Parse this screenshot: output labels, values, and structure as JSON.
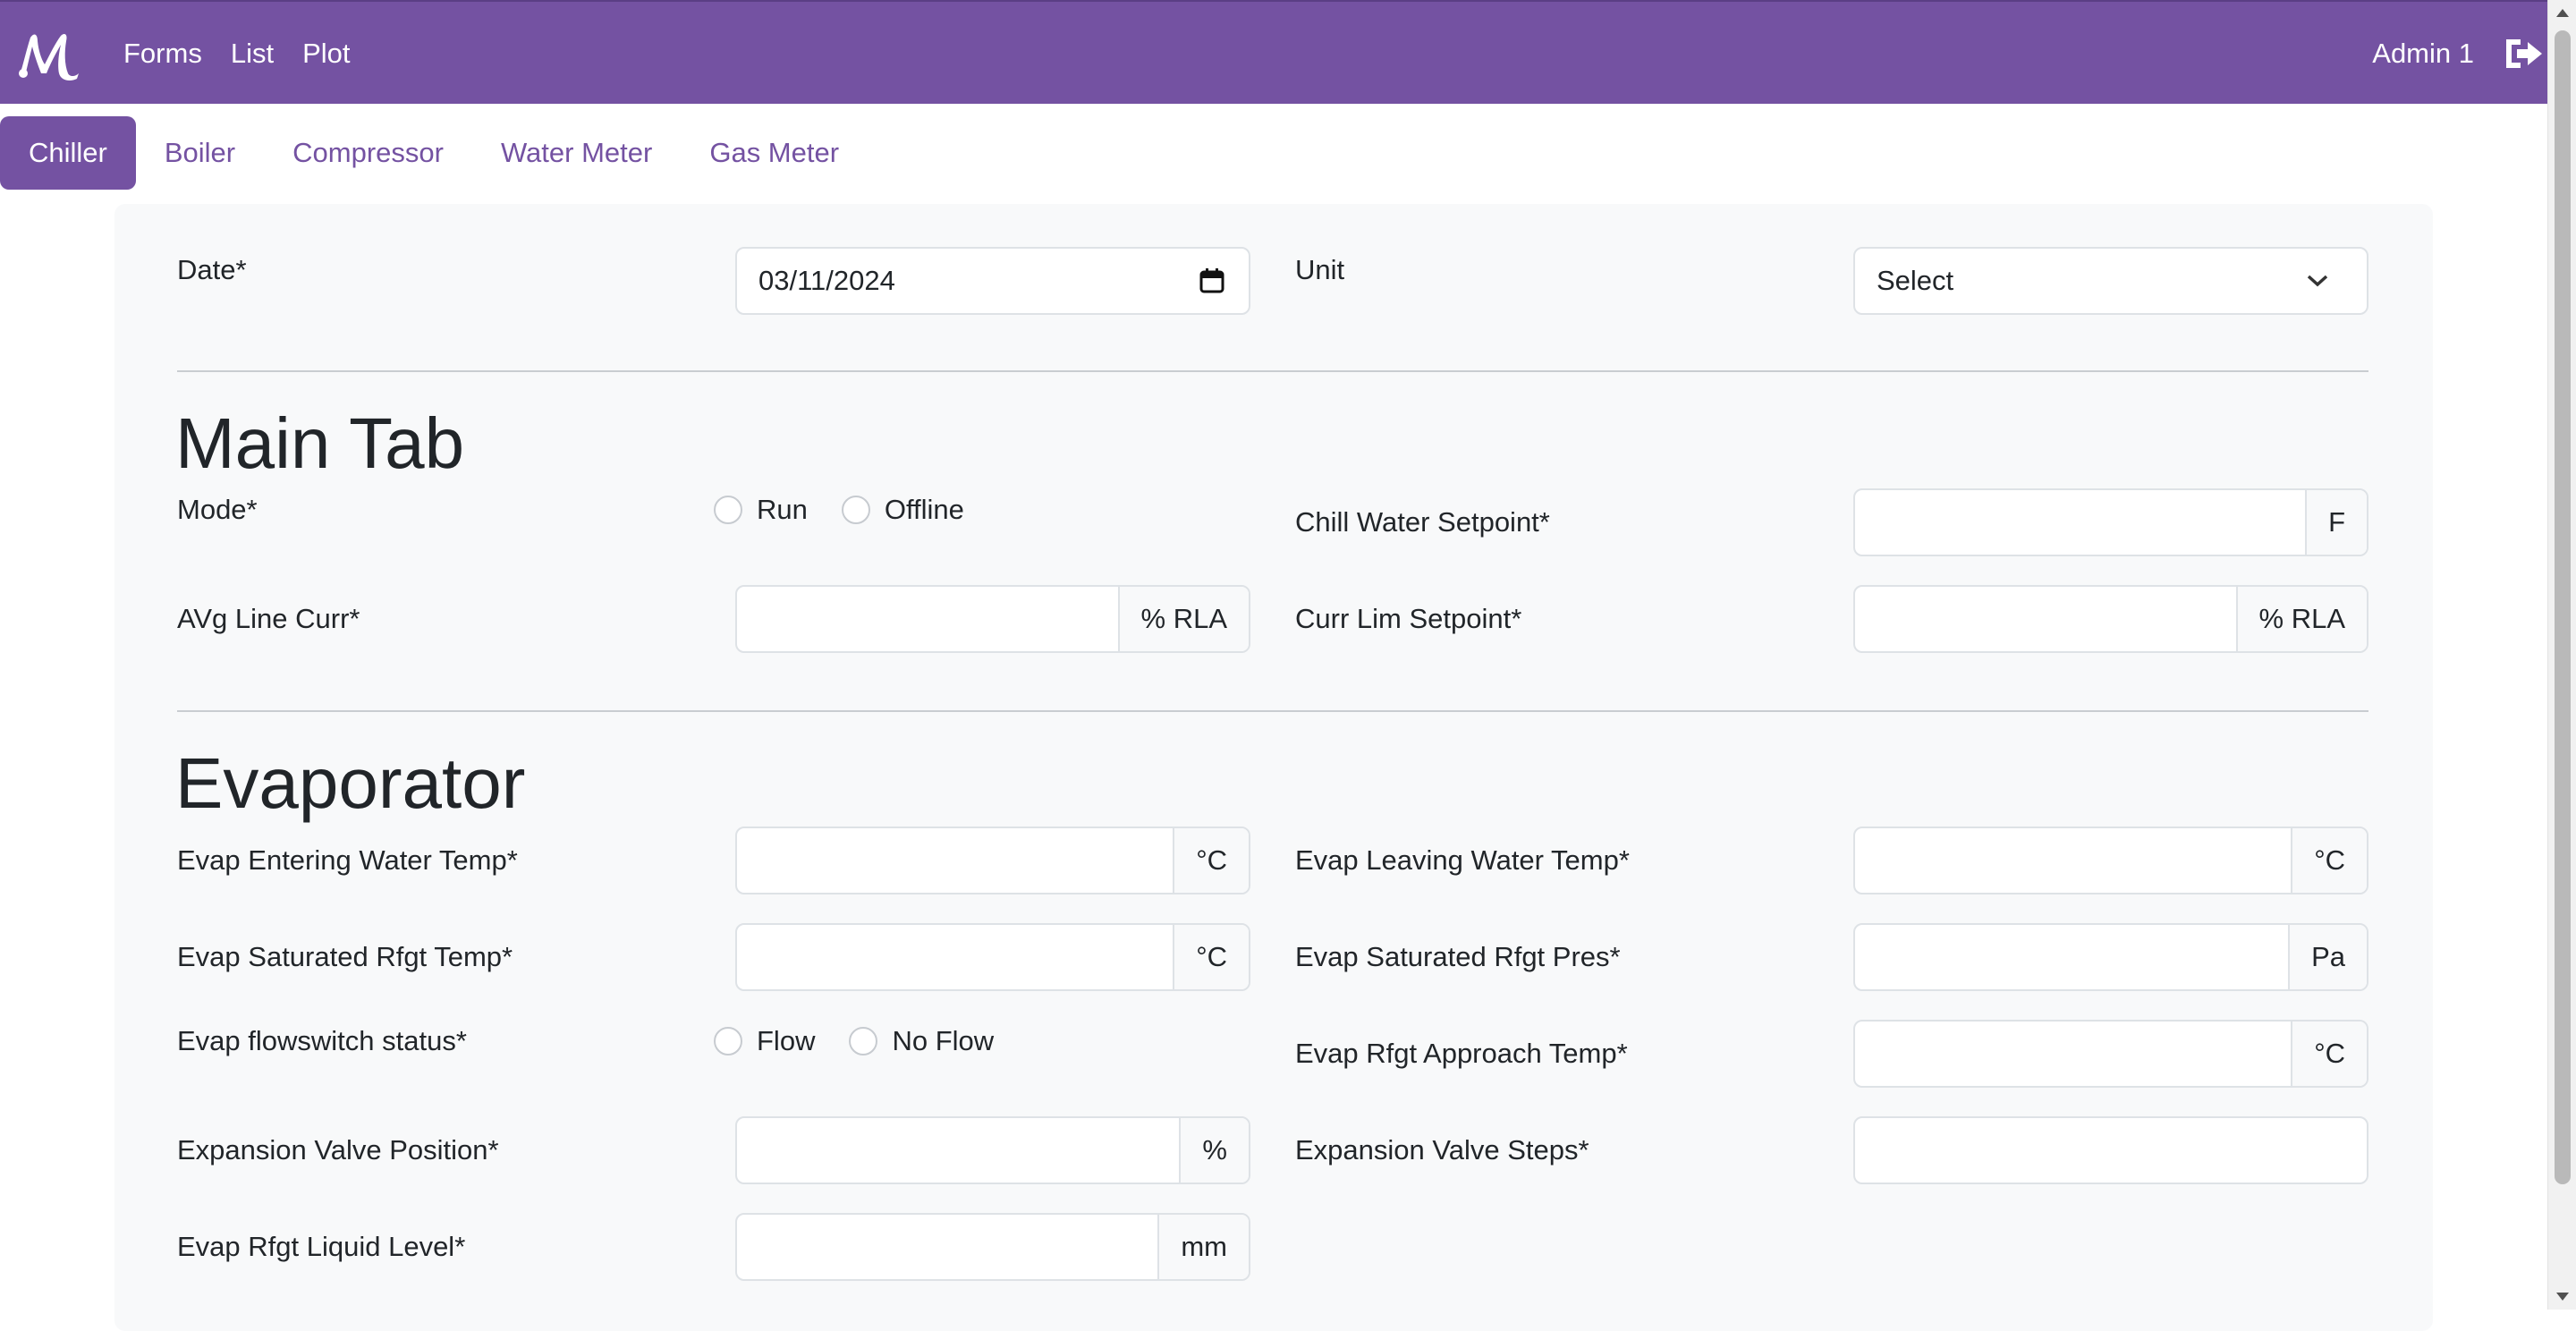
{
  "navbar": {
    "brand_icon": "m-logo-icon",
    "links": [
      "Forms",
      "List",
      "Plot"
    ],
    "user": "Admin 1",
    "logout_icon": "logout-icon",
    "color": "#7452a2"
  },
  "tabs": [
    "Chiller",
    "Boiler",
    "Compressor",
    "Water Meter",
    "Gas Meter"
  ],
  "active_tab": "Chiller",
  "header_fields": {
    "date_label": "Date*",
    "date_value": "03/11/2024",
    "unit_label": "Unit",
    "unit_value": "Select"
  },
  "main_tab": {
    "title": "Main Tab",
    "mode_label": "Mode*",
    "mode_options": [
      "Run",
      "Offline"
    ],
    "chill_water_setpoint_label": "Chill Water Setpoint*",
    "chill_water_setpoint_unit": "F",
    "avg_line_curr_label": "AVg Line Curr*",
    "avg_line_curr_unit": "% RLA",
    "curr_lim_setpoint_label": "Curr Lim Setpoint*",
    "curr_lim_setpoint_unit": "% RLA"
  },
  "evaporator": {
    "title": "Evaporator",
    "entering_water_temp_label": "Evap Entering Water Temp*",
    "entering_water_temp_unit": "°C",
    "leaving_water_temp_label": "Evap Leaving Water Temp*",
    "leaving_water_temp_unit": "°C",
    "saturated_rfgt_temp_label": "Evap Saturated Rfgt Temp*",
    "saturated_rfgt_temp_unit": "°C",
    "saturated_rfgt_pres_label": "Evap Saturated Rfgt Pres*",
    "saturated_rfgt_pres_unit": "Pa",
    "flowswitch_label": "Evap flowswitch status*",
    "flowswitch_options": [
      "Flow",
      "No Flow"
    ],
    "rfgt_approach_temp_label": "Evap Rfgt Approach Temp*",
    "rfgt_approach_temp_unit": "°C",
    "expansion_valve_position_label": "Expansion Valve Position*",
    "expansion_valve_position_unit": "%",
    "expansion_valve_steps_label": "Expansion Valve Steps*",
    "rfgt_liquid_level_label": "Evap Rfgt Liquid Level*",
    "rfgt_liquid_level_unit": "mm"
  }
}
